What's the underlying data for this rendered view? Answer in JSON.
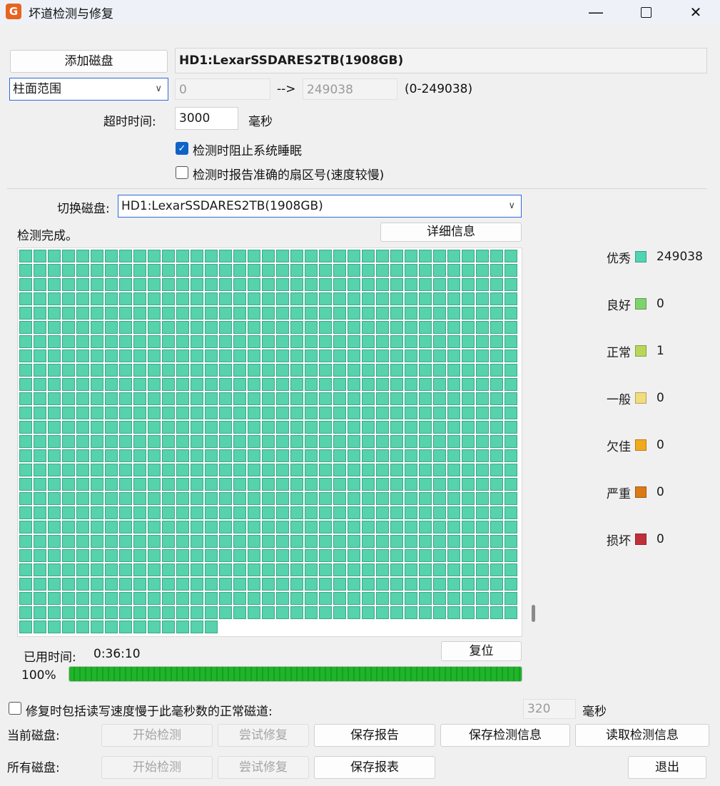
{
  "window": {
    "title": "坏道检测与修复",
    "icon_letter": "G"
  },
  "top": {
    "add_disk_button": "添加磁盘",
    "disk_name": "HD1:LexarSSDARES2TB(1908GB)",
    "range_mode": "柱面范围",
    "range_start": "0",
    "range_arrow": "-->",
    "range_end": "249038",
    "range_hint": "(0-249038)",
    "timeout_label": "超时时间:",
    "timeout_value": "3000",
    "timeout_unit": "毫秒",
    "option_prevent_sleep": "检测时阻止系统睡眠",
    "option_prevent_sleep_checked": true,
    "option_exact_sector": "检测时报告准确的扇区号(速度较慢)",
    "option_exact_sector_checked": false
  },
  "switch": {
    "label": "切换磁盘:",
    "value": "HD1:LexarSSDARES2TB(1908GB)"
  },
  "status": {
    "text": "检测完成。",
    "details_button": "详细信息"
  },
  "grid": {
    "full_rows": 26,
    "columns": 35,
    "last_row_cells": 14,
    "cell_color": "#56d2ad"
  },
  "legend": [
    {
      "label": "优秀",
      "count": "249038",
      "color": "#52d3b3"
    },
    {
      "label": "良好",
      "count": "0",
      "color": "#7ed36e"
    },
    {
      "label": "正常",
      "count": "1",
      "color": "#b9d65a"
    },
    {
      "label": "一般",
      "count": "0",
      "color": "#f2dc7c"
    },
    {
      "label": "欠佳",
      "count": "0",
      "color": "#f3a91d"
    },
    {
      "label": "严重",
      "count": "0",
      "color": "#d97a16"
    },
    {
      "label": "损坏",
      "count": "0",
      "color": "#c0303a"
    }
  ],
  "elapsed": {
    "label": "已用时间:",
    "value": "0:36:10",
    "reset_button": "复位"
  },
  "progress": {
    "percent_text": "100%",
    "value": 1.0
  },
  "repair_option": {
    "label": "修复时包括读写速度慢于此毫秒数的正常磁道:",
    "value": "320",
    "unit": "毫秒",
    "checked": false
  },
  "current_disk": {
    "label": "当前磁盘:",
    "start": "开始检测",
    "try_repair": "尝试修复",
    "save_report": "保存报告",
    "save_info": "保存检测信息",
    "load_info": "读取检测信息"
  },
  "all_disks": {
    "label": "所有磁盘:",
    "start": "开始检测",
    "try_repair": "尝试修复",
    "save_table": "保存报表",
    "exit": "退出"
  }
}
